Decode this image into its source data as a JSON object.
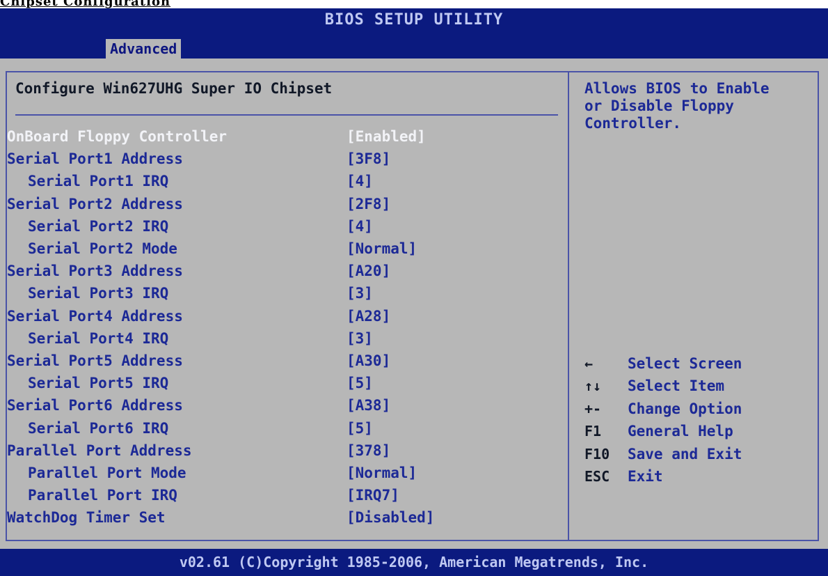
{
  "top_fragment": "Chipset Configuration",
  "header": {
    "title": "BIOS SETUP UTILITY"
  },
  "tabs": [
    {
      "label": "Advanced",
      "active": true
    }
  ],
  "main": {
    "heading": "Configure Win627UHG Super IO Chipset",
    "settings": [
      {
        "label": "OnBoard Floppy Controller",
        "value": "[Enabled]",
        "indent": false,
        "selected": true
      },
      {
        "label": "Serial Port1 Address",
        "value": "[3F8]",
        "indent": false
      },
      {
        "label": "Serial Port1 IRQ",
        "value": "[4]",
        "indent": true
      },
      {
        "label": "Serial Port2 Address",
        "value": "[2F8]",
        "indent": false
      },
      {
        "label": "Serial Port2 IRQ",
        "value": "[4]",
        "indent": true
      },
      {
        "label": "Serial Port2 Mode",
        "value": "[Normal]",
        "indent": true
      },
      {
        "label": "Serial Port3 Address",
        "value": "[A20]",
        "indent": false
      },
      {
        "label": "Serial Port3 IRQ",
        "value": "[3]",
        "indent": true
      },
      {
        "label": "Serial Port4 Address",
        "value": "[A28]",
        "indent": false
      },
      {
        "label": "Serial Port4 IRQ",
        "value": "[3]",
        "indent": true
      },
      {
        "label": "Serial Port5 Address",
        "value": "[A30]",
        "indent": false
      },
      {
        "label": "Serial Port5 IRQ",
        "value": "[5]",
        "indent": true
      },
      {
        "label": "Serial Port6 Address",
        "value": "[A38]",
        "indent": false
      },
      {
        "label": "Serial Port6 IRQ",
        "value": "[5]",
        "indent": true
      },
      {
        "label": "Parallel Port Address",
        "value": "[378]",
        "indent": false
      },
      {
        "label": "Parallel Port Mode",
        "value": "[Normal]",
        "indent": true
      },
      {
        "label": "Parallel Port IRQ",
        "value": "[IRQ7]",
        "indent": true
      },
      {
        "label": "WatchDog Timer Set",
        "value": "[Disabled]",
        "indent": false
      }
    ]
  },
  "help": {
    "text": "Allows BIOS to Enable\nor Disable Floppy\nController.",
    "keys": [
      {
        "key": "←",
        "action": "Select Screen"
      },
      {
        "key": "↑↓",
        "action": "Select Item"
      },
      {
        "key": "+-",
        "action": "Change Option"
      },
      {
        "key": "F1",
        "action": "General Help"
      },
      {
        "key": "F10",
        "action": "Save and Exit"
      },
      {
        "key": "ESC",
        "action": "Exit"
      }
    ]
  },
  "footer": {
    "text": "v02.61 (C)Copyright 1985-2006, American Megatrends, Inc."
  },
  "colors": {
    "title_bar": "#0b1a7f",
    "screen_bg": "#b7b7b7",
    "item_text": "#1c2996",
    "selected_text": "#f2f3f7",
    "border": "#4a53a8"
  }
}
